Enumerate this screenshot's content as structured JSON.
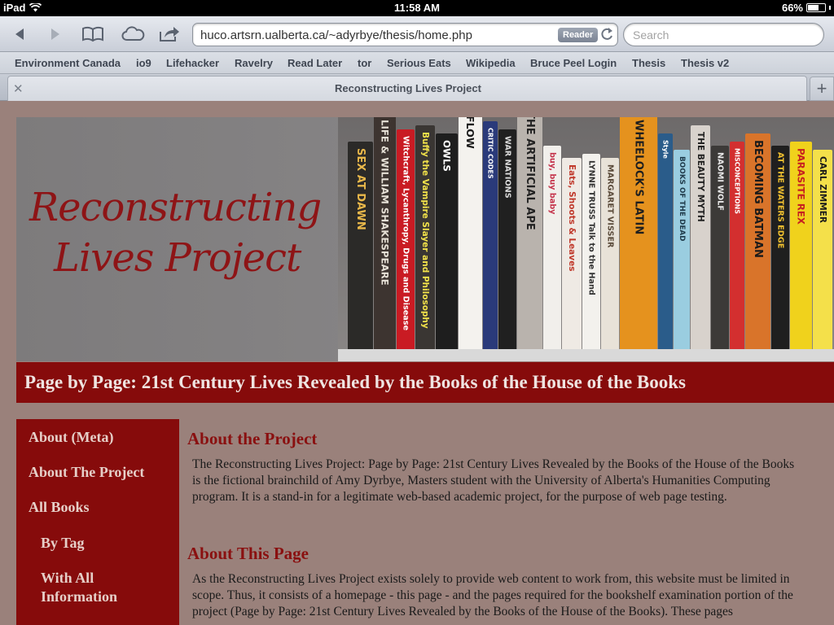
{
  "status_bar": {
    "carrier": "iPad",
    "time": "11:58 AM",
    "battery": "66%",
    "battery_level": 0.66
  },
  "toolbar": {
    "url": "huco.artsrn.ualberta.ca/~adyrbye/thesis/home.php",
    "reader_label": "Reader",
    "search_placeholder": "Search"
  },
  "bookmarks": [
    "Environment Canada",
    "io9",
    "Lifehacker",
    "Ravelry",
    "Read Later",
    "tor",
    "Serious Eats",
    "Wikipedia",
    "Bruce Peel Login",
    "Thesis",
    "Thesis v2"
  ],
  "tab": {
    "title": "Reconstructing Lives Project"
  },
  "page": {
    "site_title_line1": "Reconstructing",
    "site_title_line2": "Lives Project",
    "subtitle": "Page by Page: 21st Century Lives Revealed by the Books of the House of the Books",
    "nav": [
      "About (Meta)",
      "About The Project",
      "All Books",
      "By Tag",
      "With All Information"
    ],
    "sections": [
      {
        "heading": "About the Project",
        "body": "The Reconstructing Lives Project: Page by Page: 21st Century Lives Revealed by the Books of the House of the Books is the fictional brainchild of Amy Dyrbye, Masters student with the University of Alberta's Humanities Computing program. It is a stand-in for a legitimate web-based academic project, for the purpose of web page testing."
      },
      {
        "heading": "About This Page",
        "body": "As the Reconstructing Lives Project exists solely to provide web content to work from, this website must be limited in scope. Thus, it consists of a homepage - this page - and the pages required for the bookshelf examination portion of the project (Page by Page: 21st Century Lives Revealed by the Books of the House of the Books). These pages"
      }
    ]
  },
  "books": [
    {
      "title": "SEX AT DAWN",
      "color": "#2b2a28",
      "text": "#e9b84a"
    },
    {
      "title": "LIFE & WILLIAM SHAKESPEARE",
      "color": "#3d3430",
      "text": "#e6e0d6"
    },
    {
      "title": "Witchcraft, Lycanthropy, Drugs and Disease",
      "color": "#c91b23",
      "text": "#ffffff"
    },
    {
      "title": "Buffy the Vampire Slayer and Philosophy",
      "color": "#3a3633",
      "text": "#f2e24a"
    },
    {
      "title": "OWLS",
      "color": "#1e1e1e",
      "text": "#ffffff"
    },
    {
      "title": "FLOW",
      "color": "#f4f2ee",
      "text": "#1a1a1a"
    },
    {
      "title": "CRITIC CODES",
      "color": "#2a3a7a",
      "text": "#ffffff"
    },
    {
      "title": "WAR NATIONS",
      "color": "#202020",
      "text": "#dcdcdc"
    },
    {
      "title": "THE ARTIFICIAL APE",
      "color": "#b9b3ad",
      "text": "#222222"
    },
    {
      "title": "buy, buy baby",
      "color": "#f1efeb",
      "text": "#c4324a"
    },
    {
      "title": "Eats, Shoots & Leaves",
      "color": "#efeae4",
      "text": "#c0392b"
    },
    {
      "title": "LYNNE TRUSS Talk to the Hand",
      "color": "#f3f1ed",
      "text": "#333333"
    },
    {
      "title": "MARGARET VISSER",
      "color": "#e8e2d8",
      "text": "#5a4a3a"
    },
    {
      "title": "WHEELOCK'S LATIN",
      "color": "#e5921e",
      "text": "#1f1f1f"
    },
    {
      "title": "Style",
      "color": "#2a5c8a",
      "text": "#ffffff"
    },
    {
      "title": "BOOKS OF THE DEAD",
      "color": "#9acde0",
      "text": "#1f3a4a"
    },
    {
      "title": "THE BEAUTY MYTH",
      "color": "#d8d2cc",
      "text": "#222222"
    },
    {
      "title": "NAOMI WOLF",
      "color": "#3c3a38",
      "text": "#e8e8e8"
    },
    {
      "title": "MISCONCEPTIONS",
      "color": "#d32f2f",
      "text": "#ffffff"
    },
    {
      "title": "BECOMING BATMAN",
      "color": "#d9742a",
      "text": "#1a1a1a"
    },
    {
      "title": "AT THE WATERS EDGE",
      "color": "#1f1f1f",
      "text": "#f2c230"
    },
    {
      "title": "PARASITE REX",
      "color": "#f0d21c",
      "text": "#c62020"
    },
    {
      "title": "CARL ZIMMER",
      "color": "#f4e04a",
      "text": "#1a1a1a"
    }
  ]
}
